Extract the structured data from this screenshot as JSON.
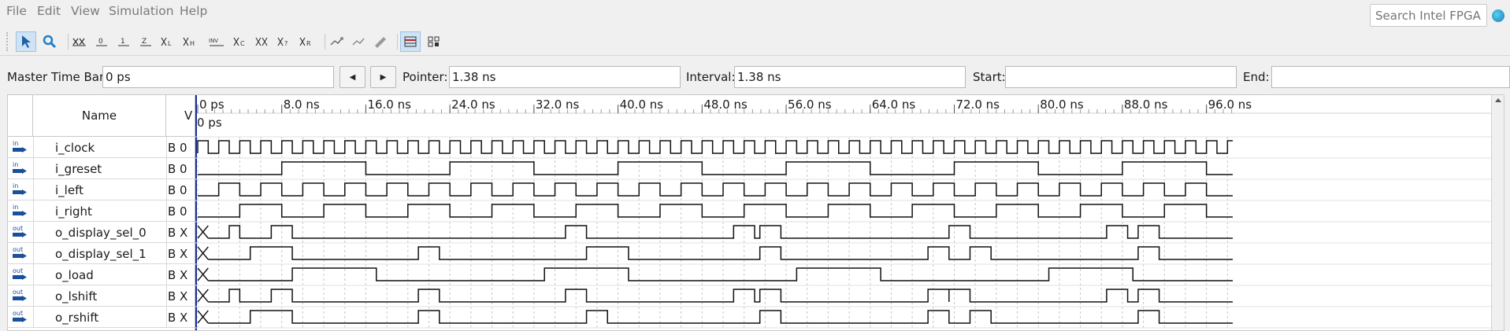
{
  "menu": {
    "file": "File",
    "edit": "Edit",
    "view": "View",
    "simulation": "Simulation",
    "help": "Help"
  },
  "search": {
    "placeholder": "Search Intel FPGA"
  },
  "toolbar": {
    "icons": [
      "selection-tool-icon",
      "zoom-tool-icon",
      "forcing-unknown-icon",
      "force-low-icon",
      "force-high-icon",
      "force-high-impedance-icon",
      "force-weak-low-icon",
      "force-weak-high-icon",
      "invert-icon",
      "count-value-icon",
      "forcing-clock-icon",
      "arbitrary-value-icon",
      "random-values-icon",
      "count-value-r-icon",
      "insert-node-icon",
      "delete-node-icon",
      "edit-node-icon",
      "snap-to-grid-icon",
      "grouped-icon"
    ]
  },
  "timebar": {
    "master_label": "Master Time Bar:",
    "master_value": "0 ps",
    "pointer_label": "Pointer:",
    "pointer_value": "1.38 ns",
    "interval_label": "Interval:",
    "interval_value": "1.38 ns",
    "start_label": "Start:",
    "start_value": "",
    "end_label": "End:",
    "end_value": ""
  },
  "table": {
    "name_header": "Name",
    "value_header": "V",
    "signals": [
      {
        "dir": "in",
        "name": "i_clock",
        "value": "B 0"
      },
      {
        "dir": "in",
        "name": "i_greset",
        "value": "B 0"
      },
      {
        "dir": "in",
        "name": "i_left",
        "value": "B 0"
      },
      {
        "dir": "in",
        "name": "i_right",
        "value": "B 0"
      },
      {
        "dir": "out",
        "name": "o_display_sel_0",
        "value": "B X"
      },
      {
        "dir": "out",
        "name": "o_display_sel_1",
        "value": "B X"
      },
      {
        "dir": "out",
        "name": "o_load",
        "value": "B X"
      },
      {
        "dir": "out",
        "name": "o_lshift",
        "value": "B X"
      },
      {
        "dir": "out",
        "name": "o_rshift",
        "value": "B X"
      }
    ]
  },
  "waveform": {
    "time_labels": [
      "0 ps",
      "8.0 ns",
      "16.0 ns",
      "24.0 ns",
      "32.0 ns",
      "40.0 ns",
      "48.0 ns",
      "56.0 ns",
      "64.0 ns",
      "72.0 ns",
      "80.0 ns",
      "88.0 ns",
      "96.0 ns"
    ],
    "cursor_label": "0 ps",
    "time_range_ns": [
      0,
      98.5
    ],
    "clock_period_ns": 2.0,
    "traces": [
      {
        "signal": "i_clock",
        "start": 0,
        "edges_ns": []
      },
      {
        "signal": "i_greset",
        "start": 0,
        "edges_ns": [
          8,
          16,
          24,
          32,
          40,
          48,
          56,
          64,
          72,
          80,
          88,
          96
        ]
      },
      {
        "signal": "i_left",
        "start": 0,
        "edges_ns": [
          2,
          4,
          6,
          8,
          10,
          12,
          14,
          16,
          18,
          20,
          22,
          24,
          26,
          28,
          30,
          32,
          34,
          36,
          38,
          40,
          42,
          44,
          46,
          48,
          50,
          52,
          54,
          56,
          58,
          60,
          62,
          64,
          66,
          68,
          70,
          72,
          74,
          76,
          78,
          80,
          82,
          84,
          86,
          88,
          90,
          92,
          94,
          96
        ]
      },
      {
        "signal": "i_right",
        "start": 0,
        "edges_ns": [
          4,
          8,
          12,
          16,
          20,
          24,
          28,
          32,
          36,
          40,
          44,
          48,
          52,
          56,
          60,
          64,
          68,
          72,
          76,
          80,
          84,
          88,
          92,
          96
        ]
      },
      {
        "signal": "o_display_sel_0",
        "start": "X",
        "unknown_until_ns": 1,
        "edges_ns": [
          3,
          4,
          7,
          9,
          35,
          37,
          51,
          53,
          53.5,
          55.5,
          71.5,
          73.5,
          86.5,
          88.5,
          89.5,
          91.5
        ]
      },
      {
        "signal": "o_display_sel_1",
        "start": "X",
        "unknown_until_ns": 1,
        "edges_ns": [
          5,
          9,
          21,
          23,
          37,
          41,
          53.5,
          55.5,
          69.5,
          71.5,
          73.5,
          75.5,
          89.5,
          91.5
        ]
      },
      {
        "signal": "o_load",
        "start": "X",
        "unknown_until_ns": 1,
        "edges_ns": [
          9,
          17,
          33,
          41,
          57,
          65,
          81,
          89
        ]
      },
      {
        "signal": "o_lshift",
        "start": "X",
        "unknown_until_ns": 1,
        "edges_ns": [
          3,
          4,
          7,
          9,
          21,
          23,
          35,
          37,
          51,
          53,
          53.5,
          55.5,
          69.5,
          71.5,
          71.5,
          73.5,
          86.5,
          88.5,
          89.5,
          91.5
        ]
      },
      {
        "signal": "o_rshift",
        "start": "X",
        "unknown_until_ns": 1,
        "edges_ns": [
          5,
          9,
          21,
          23,
          37,
          39,
          53.5,
          55.5,
          69.5,
          71.5,
          73.5,
          75.5,
          89.5,
          91.5
        ]
      }
    ]
  }
}
